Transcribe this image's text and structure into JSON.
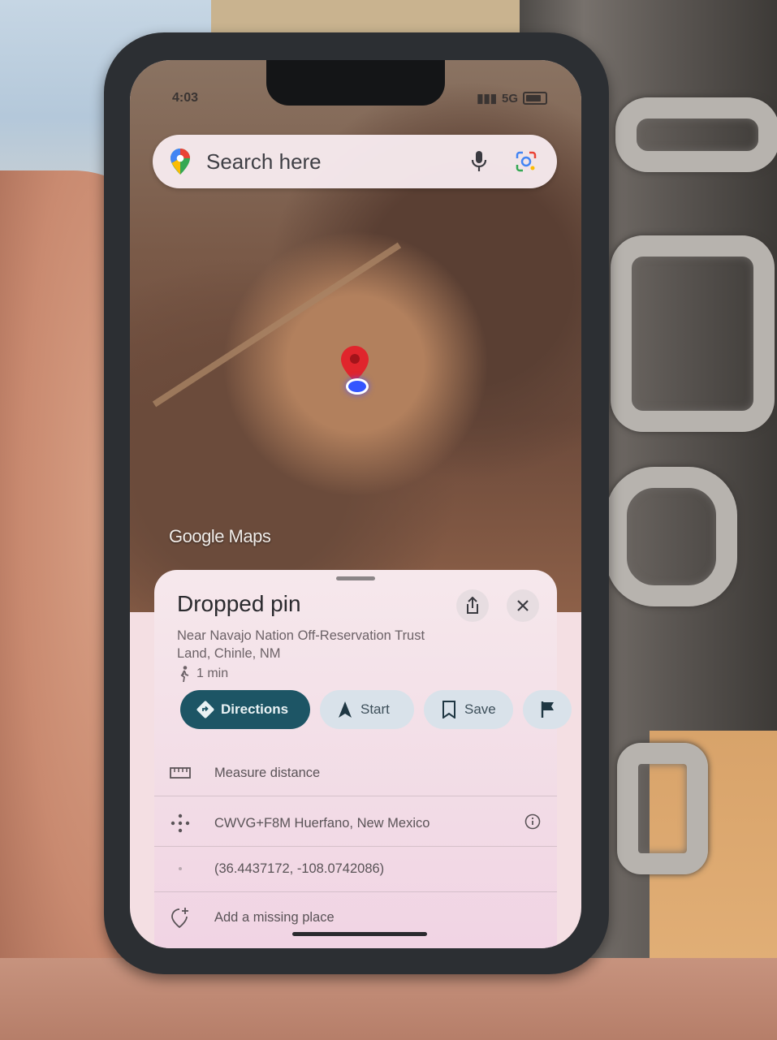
{
  "status_bar": {
    "time": "4:03",
    "network": "5G"
  },
  "search": {
    "placeholder": "Search here"
  },
  "map": {
    "watermark": "Google Maps"
  },
  "place": {
    "title": "Dropped pin",
    "address": "Near Navajo Nation Off-Reservation Trust Land, Chinle, NM",
    "walk_time": "1 min"
  },
  "actions": {
    "directions": "Directions",
    "start": "Start",
    "save": "Save"
  },
  "details": {
    "measure": "Measure distance",
    "plus_code": "CWVG+F8M Huerfano, New Mexico",
    "coordinates": "(36.4437172, -108.0742086)",
    "add_place": "Add a missing place"
  },
  "colors": {
    "directions_chip": "#1d5565",
    "chip": "#d9e2ea",
    "pin": "#e0252c",
    "location_dot": "#3355ff"
  }
}
